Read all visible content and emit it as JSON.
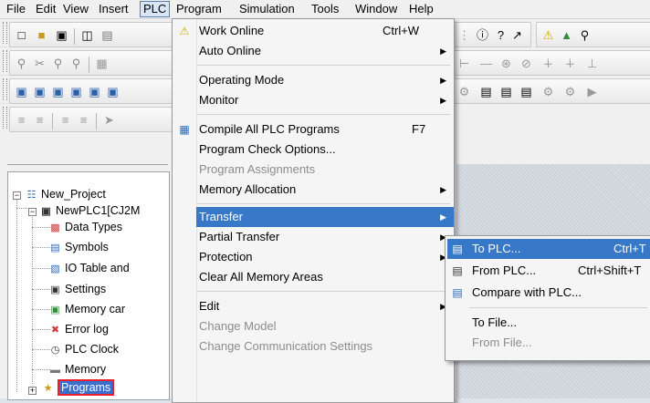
{
  "menubar": [
    "File",
    "Edit",
    "View",
    "Insert",
    "PLC",
    "Program",
    "Simulation",
    "Tools",
    "Window",
    "Help"
  ],
  "plc_menu": {
    "items": [
      {
        "label": "Work Online",
        "shortcut": "Ctrl+W",
        "icon": "warning-icon",
        "submenu": false,
        "disabled": false
      },
      {
        "label": "Auto Online",
        "shortcut": "",
        "submenu": true,
        "disabled": false
      },
      {
        "label": "Operating Mode",
        "shortcut": "",
        "submenu": true,
        "disabled": false
      },
      {
        "label": "Monitor",
        "shortcut": "",
        "submenu": true,
        "disabled": false
      },
      {
        "label": "Compile All PLC Programs",
        "shortcut": "F7",
        "icon": "compile-icon",
        "submenu": false,
        "disabled": false
      },
      {
        "label": "Program Check Options...",
        "shortcut": "",
        "submenu": false,
        "disabled": false
      },
      {
        "label": "Program Assignments",
        "shortcut": "",
        "submenu": false,
        "disabled": true
      },
      {
        "label": "Memory Allocation",
        "shortcut": "",
        "submenu": true,
        "disabled": false
      },
      {
        "label": "Transfer",
        "shortcut": "",
        "submenu": true,
        "disabled": false,
        "highlighted": true
      },
      {
        "label": "Partial Transfer",
        "shortcut": "",
        "submenu": true,
        "disabled": false
      },
      {
        "label": "Protection",
        "shortcut": "",
        "submenu": true,
        "disabled": false
      },
      {
        "label": "Clear All Memory Areas",
        "shortcut": "",
        "submenu": false,
        "disabled": false
      },
      {
        "label": "Edit",
        "shortcut": "",
        "submenu": true,
        "disabled": false
      },
      {
        "label": "Change Model",
        "shortcut": "",
        "submenu": false,
        "disabled": true
      },
      {
        "label": "Change Communication Settings",
        "shortcut": "",
        "submenu": false,
        "disabled": true
      }
    ]
  },
  "transfer_menu": {
    "items": [
      {
        "label": "To PLC...",
        "shortcut": "Ctrl+T",
        "icon": "to-plc-icon",
        "highlighted": true,
        "disabled": false
      },
      {
        "label": "From PLC...",
        "shortcut": "Ctrl+Shift+T",
        "icon": "from-plc-icon",
        "disabled": false
      },
      {
        "label": "Compare with PLC...",
        "shortcut": "",
        "icon": "compare-icon",
        "disabled": false
      },
      {
        "label": "To File...",
        "shortcut": "",
        "disabled": false
      },
      {
        "label": "From File...",
        "shortcut": "",
        "disabled": true
      }
    ]
  },
  "tree": {
    "project": "New_Project",
    "plc": "NewPLC1[CJ2M",
    "children": [
      "Data Types",
      "Symbols",
      "IO Table and",
      "Settings",
      "Memory car",
      "Error log",
      "PLC Clock",
      "Memory",
      "Programs"
    ]
  },
  "colors": {
    "highlight": "#3778c8",
    "programs_outline": "#e8202a"
  }
}
